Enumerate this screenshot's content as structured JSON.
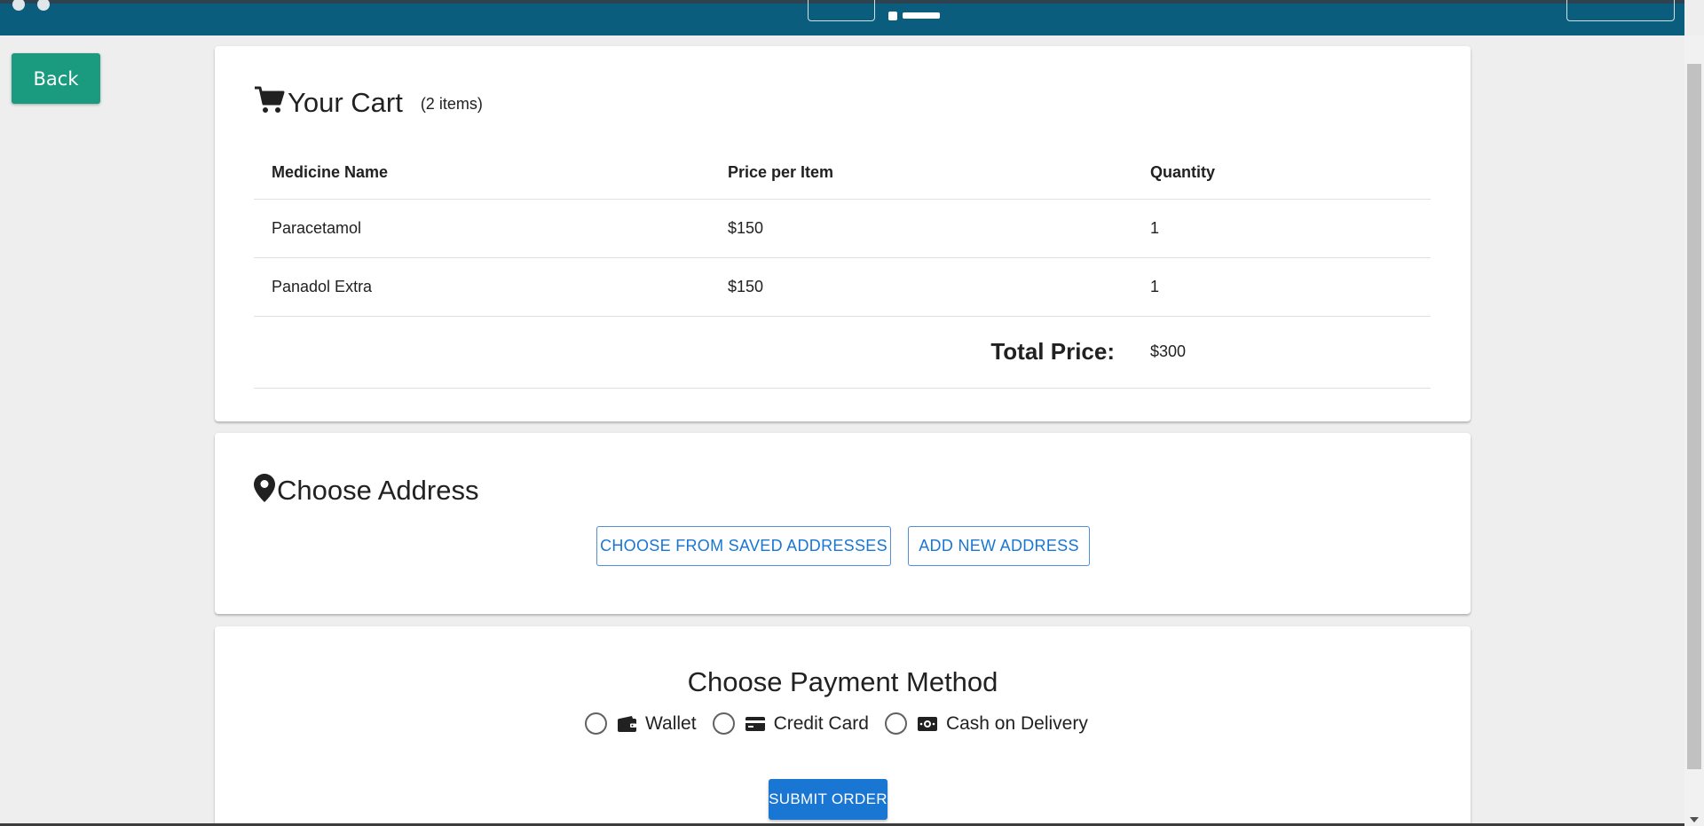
{
  "back": {
    "label": "Back"
  },
  "cart": {
    "title": "Your Cart",
    "count": "(2 items)",
    "headers": [
      "Medicine Name",
      "Price per Item",
      "Quantity"
    ],
    "rows": [
      {
        "name": "Paracetamol",
        "price": "$150",
        "qty": "1"
      },
      {
        "name": "Panadol Extra",
        "price": "$150",
        "qty": "1"
      }
    ],
    "total_label": "Total Price:",
    "total_value": "$300"
  },
  "address": {
    "title": "Choose Address",
    "saved_label": "CHOOSE FROM SAVED ADDRESSES",
    "new_label": "ADD NEW ADDRESS"
  },
  "payment": {
    "title": "Choose Payment Method",
    "options": [
      {
        "label": "Wallet",
        "icon": "wallet-icon"
      },
      {
        "label": "Credit Card",
        "icon": "credit-card-icon"
      },
      {
        "label": "Cash on Delivery",
        "icon": "cash-icon"
      }
    ],
    "submit_label": "SUBMIT ORDER"
  },
  "colors": {
    "header": "#0b5d7e",
    "back_button": "#1a9a7e",
    "primary": "#1976d2"
  }
}
